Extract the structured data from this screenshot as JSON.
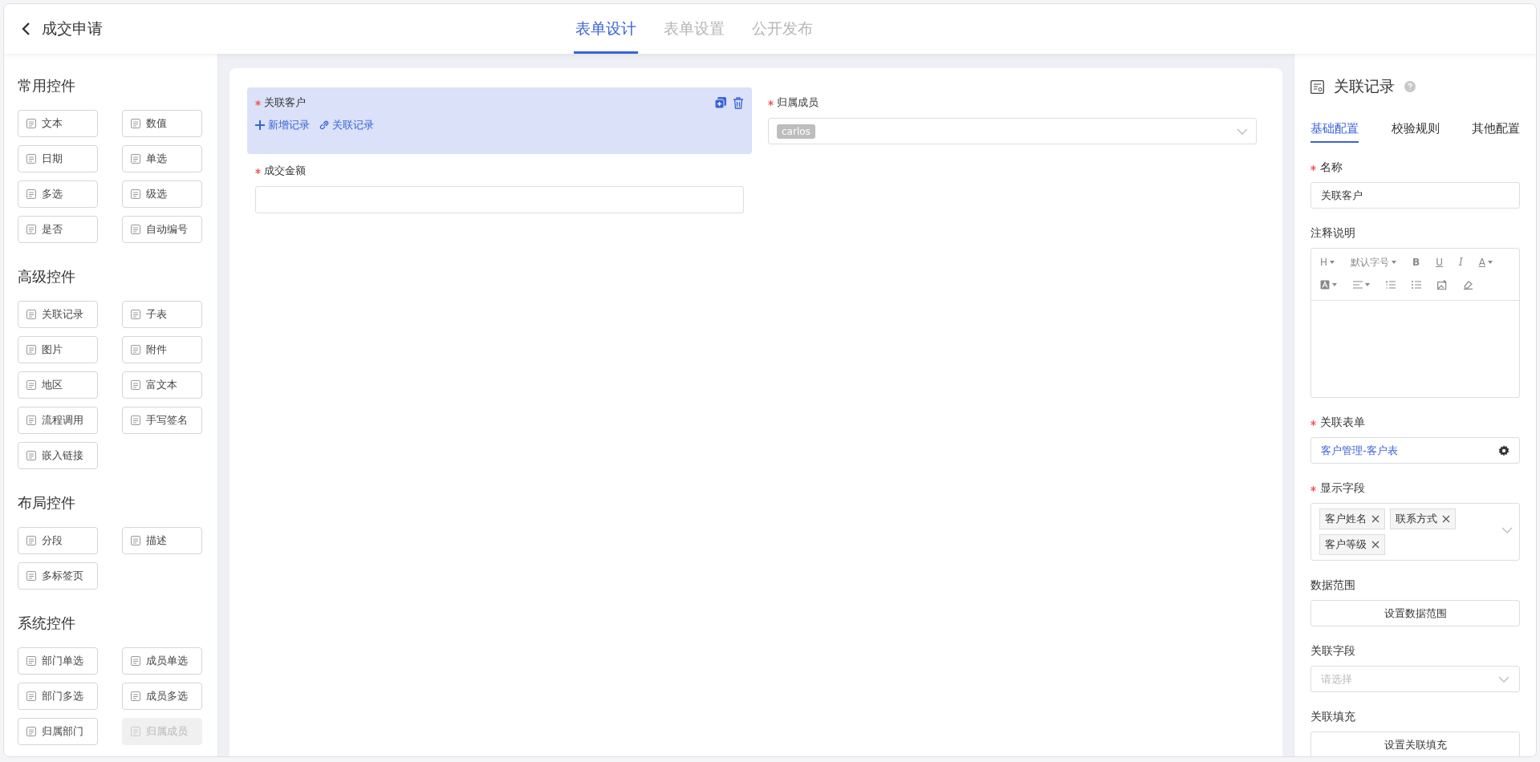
{
  "header": {
    "title": "成交申请",
    "tabs": [
      {
        "label": "表单设计",
        "selected": true
      },
      {
        "label": "表单设置",
        "selected": false
      },
      {
        "label": "公开发布",
        "selected": false
      }
    ]
  },
  "palette": {
    "sections": [
      {
        "title": "常用控件",
        "items": [
          {
            "label": "文本",
            "disabled": false
          },
          {
            "label": "数值",
            "disabled": false
          },
          {
            "label": "日期",
            "disabled": false
          },
          {
            "label": "单选",
            "disabled": false
          },
          {
            "label": "多选",
            "disabled": false
          },
          {
            "label": "级选",
            "disabled": false
          },
          {
            "label": "是否",
            "disabled": false
          },
          {
            "label": "自动编号",
            "disabled": false
          }
        ]
      },
      {
        "title": "高级控件",
        "items": [
          {
            "label": "关联记录",
            "disabled": false
          },
          {
            "label": "子表",
            "disabled": false
          },
          {
            "label": "图片",
            "disabled": false
          },
          {
            "label": "附件",
            "disabled": false
          },
          {
            "label": "地区",
            "disabled": false
          },
          {
            "label": "富文本",
            "disabled": false
          },
          {
            "label": "流程调用",
            "disabled": false
          },
          {
            "label": "手写签名",
            "disabled": false
          },
          {
            "label": "嵌入链接",
            "disabled": false
          }
        ]
      },
      {
        "title": "布局控件",
        "items": [
          {
            "label": "分段",
            "disabled": false
          },
          {
            "label": "描述",
            "disabled": false
          },
          {
            "label": "多标签页",
            "disabled": false
          }
        ]
      },
      {
        "title": "系统控件",
        "items": [
          {
            "label": "部门单选",
            "disabled": false
          },
          {
            "label": "成员单选",
            "disabled": false
          },
          {
            "label": "部门多选",
            "disabled": false
          },
          {
            "label": "成员多选",
            "disabled": false
          },
          {
            "label": "归属部门",
            "disabled": false
          },
          {
            "label": "归属成员",
            "disabled": true
          }
        ]
      }
    ]
  },
  "canvas": {
    "fields": [
      {
        "kind": "relation",
        "label": "关联客户",
        "required": true,
        "selected": true,
        "actions": [
          "新增记录",
          "关联记录"
        ]
      },
      {
        "kind": "member",
        "label": "归属成员",
        "required": true,
        "selected": false,
        "tags": [
          "carlos"
        ]
      },
      {
        "kind": "input",
        "label": "成交金额",
        "required": true,
        "selected": false
      }
    ]
  },
  "props": {
    "title": "关联记录",
    "tabs": [
      {
        "label": "基础配置",
        "selected": true
      },
      {
        "label": "校验规则",
        "selected": false
      },
      {
        "label": "其他配置",
        "selected": false
      }
    ],
    "fields": [
      {
        "kind": "input",
        "label": "名称",
        "required": true,
        "value": "关联客户"
      },
      {
        "kind": "editor",
        "label": "注释说明",
        "required": false,
        "toolbar": [
          {
            "label": "H",
            "dropdown": true
          },
          {
            "label": "默认字号",
            "dropdown": true
          },
          {
            "label": "B",
            "dropdown": false
          },
          {
            "label": "U",
            "dropdown": false
          },
          {
            "label": "I",
            "dropdown": false
          },
          {
            "label": "A",
            "dropdown": true
          }
        ]
      },
      {
        "kind": "form-select",
        "label": "关联表单",
        "required": true,
        "value": "客户管理-客户表"
      },
      {
        "kind": "tags",
        "label": "显示字段",
        "required": true,
        "tags": [
          "客户姓名",
          "联系方式",
          "客户等级"
        ]
      },
      {
        "kind": "button",
        "label": "数据范围",
        "required": false,
        "button": "设置数据范围"
      },
      {
        "kind": "select",
        "label": "关联字段",
        "required": false,
        "placeholder": "请选择"
      },
      {
        "kind": "button",
        "label": "关联填充",
        "required": false,
        "button": "设置关联填充"
      }
    ]
  }
}
